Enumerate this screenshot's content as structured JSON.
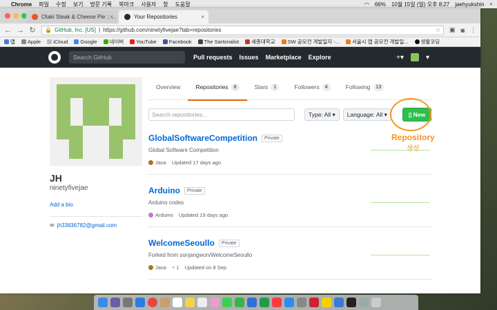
{
  "menubar": {
    "app": "Chrome",
    "menus": [
      "파일",
      "수정",
      "보기",
      "방문 기록",
      "북마크",
      "사용자",
      "창",
      "도움말"
    ],
    "battery": "66%",
    "datetime": "10월 15일 (일) 오후 8:27",
    "user": "jaehyukshin"
  },
  "browser": {
    "tabs": [
      {
        "title": "Otaki Steak & Cheese Pie :: ...",
        "active": false
      },
      {
        "title": "Your Repositories",
        "active": true
      }
    ],
    "secure_label": "GitHub, Inc. [US]",
    "url": "https://github.com/ninetyfivejae?tab=repositories",
    "bookmarks": [
      "앱",
      "Apple",
      "iCloud",
      "Google",
      "네이버",
      "YouTube",
      "Facebook",
      "The Sartorialist",
      "세종대학교",
      "SW 공모전 개발일지 -...",
      "서울시 앱 공모전 개발일...",
      "생활코딩"
    ]
  },
  "github": {
    "search_placeholder": "Search GitHub",
    "nav": [
      "Pull requests",
      "Issues",
      "Marketplace",
      "Explore"
    ],
    "plus": "+▾"
  },
  "profile": {
    "fullname": "JH",
    "username": "ninetyfivejae",
    "add_bio": "Add a bio",
    "email": "jh33836782@gmail.com"
  },
  "tabs": [
    {
      "label": "Overview",
      "count": ""
    },
    {
      "label": "Repositories",
      "count": "8"
    },
    {
      "label": "Stars",
      "count": "1"
    },
    {
      "label": "Followers",
      "count": "4"
    },
    {
      "label": "Following",
      "count": "13"
    }
  ],
  "filter": {
    "search_placeholder": "Search repositories...",
    "type_label": "Type: All ▾",
    "language_label": "Language: All ▾",
    "new_label": "New"
  },
  "annotation": {
    "line1": "Repository",
    "line2": "생성",
    "color": "#f7941d"
  },
  "repos": [
    {
      "name": "GlobalSoftwareCompetition",
      "badge": "Private",
      "desc": "Global Software Competition",
      "lang": "Java",
      "lang_color": "#b07219",
      "forks": "",
      "updated": "Updated 17 days ago"
    },
    {
      "name": "Arduino",
      "badge": "Private",
      "desc": "Arduino codes",
      "lang": "Arduino",
      "lang_color": "#bd79d1",
      "forks": "",
      "updated": "Updated 19 days ago"
    },
    {
      "name": "WelcomeSeoullo",
      "badge": "Private",
      "desc": "Forked from sonjangwon/WelcomeSeoullo",
      "lang": "Java",
      "lang_color": "#b07219",
      "forks": "1",
      "updated": "Updated on 8 Sep"
    }
  ]
}
